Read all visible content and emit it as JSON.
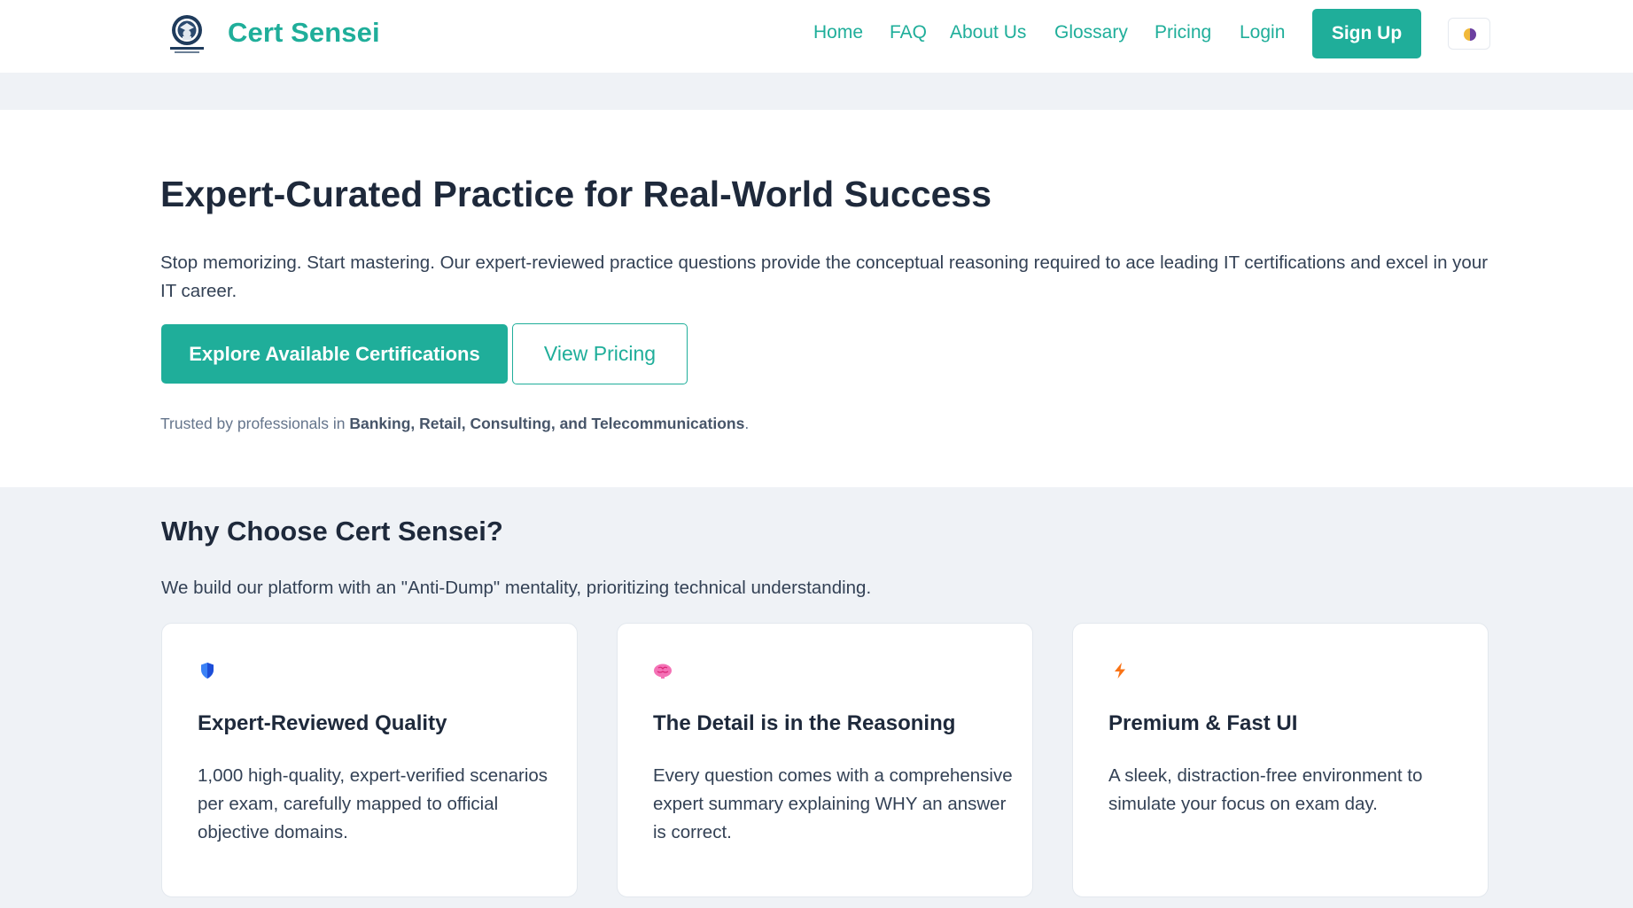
{
  "header": {
    "brand": "Cert Sensei",
    "nav": [
      {
        "label": "Home"
      },
      {
        "label": "FAQ"
      },
      {
        "label": "About Us"
      },
      {
        "label": "Glossary"
      },
      {
        "label": "Pricing"
      },
      {
        "label": "Login"
      }
    ],
    "signup_label": "Sign Up",
    "theme_toggle_icon": "half-moon-icon"
  },
  "hero": {
    "title": "Expert-Curated Practice for Real-World Success",
    "description": "Stop memorizing. Start mastering. Our expert-reviewed practice questions provide the conceptual reasoning required to ace leading IT certifications and excel in your IT career.",
    "primary_cta": "Explore Available Certifications",
    "secondary_cta": "View Pricing",
    "trusted_prefix": "Trusted by professionals in ",
    "trusted_industries": "Banking, Retail, Consulting, and Telecommunications",
    "trusted_suffix": "."
  },
  "why": {
    "title": "Why Choose Cert Sensei?",
    "subtitle": "We build our platform with an \"Anti-Dump\" mentality, prioritizing technical understanding.",
    "cards": [
      {
        "icon": "shield-icon",
        "title": "Expert-Reviewed Quality",
        "text": "1,000 high-quality, expert-verified scenarios per exam, carefully mapped to official objective domains."
      },
      {
        "icon": "brain-icon",
        "title": "The Detail is in the Reasoning",
        "text": "Every question comes with a comprehensive expert summary explaining WHY an answer is correct."
      },
      {
        "icon": "lightning-icon",
        "title": "Premium & Fast UI",
        "text": "A sleek, distraction-free environment to simulate your focus on exam day."
      }
    ]
  },
  "colors": {
    "accent": "#1fae9a",
    "heading": "#1e293b",
    "body_text": "#334155",
    "muted": "#64748b",
    "page_bg": "#eff2f6"
  }
}
